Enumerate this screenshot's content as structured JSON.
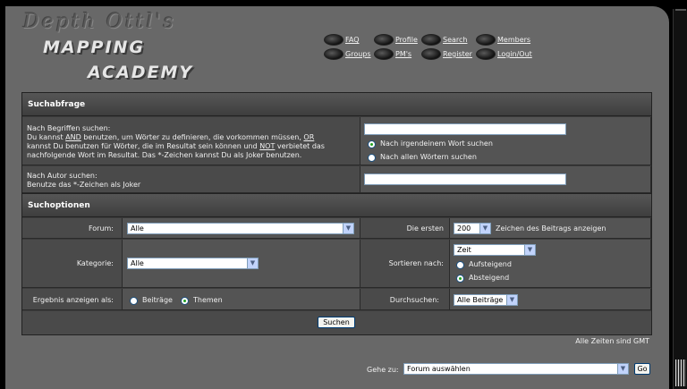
{
  "logo": {
    "line1": "Depth Ottl's",
    "line2": "MAPPING",
    "line3": "ACADEMY"
  },
  "nav": {
    "faq": "FAQ",
    "profile": "Profile",
    "search": "Search",
    "members": "Members",
    "groups": "Groups",
    "pms": "PM's",
    "register": "Register",
    "login": "Login/Out"
  },
  "search_query": {
    "header": "Suchabfrage",
    "terms_label": "Nach Begriffen suchen:",
    "terms_help_1": "Du kannst",
    "and_word": "AND",
    "terms_help_2": "benutzen, um Wörter zu definieren, die vorkommen müssen,",
    "or_word": "OR",
    "terms_help_3": "kannst Du benutzen für Wörter, die im Resultat sein können und",
    "not_word": "NOT",
    "terms_help_4": "verbietet das",
    "terms_help_5": "nachfolgende Wort im Resultat. Das *-Zeichen kannst Du als Joker benutzen.",
    "terms_value": "",
    "any_words": "Nach irgendeinem Wort suchen",
    "all_words": "Nach allen Wörtern suchen",
    "author_label": "Nach Autor suchen:",
    "author_help": "Benutze das *-Zeichen als Joker",
    "author_value": ""
  },
  "options": {
    "header": "Suchoptionen",
    "forum_label": "Forum:",
    "forum_value": "Alle",
    "first_label": "Die ersten",
    "first_value": "200",
    "first_suffix": "Zeichen des Beitrags anzeigen",
    "category_label": "Kategorie:",
    "category_value": "Alle",
    "sort_label": "Sortieren nach:",
    "sort_value": "Zeit",
    "asc": "Aufsteigend",
    "desc": "Absteigend",
    "results_label": "Ergebnis anzeigen als:",
    "posts": "Beiträge",
    "topics": "Themen",
    "search_in_label": "Durchsuchen:",
    "search_in_value": "Alle Beiträge",
    "submit": "Suchen"
  },
  "footer": {
    "timezone": "Alle Zeiten sind GMT",
    "jump_label": "Gehe zu:",
    "jump_value": "Forum auswählen",
    "go": "Go"
  },
  "colors": {
    "panel": "#686868",
    "table": "#4a4a4a",
    "background": "#000000"
  }
}
